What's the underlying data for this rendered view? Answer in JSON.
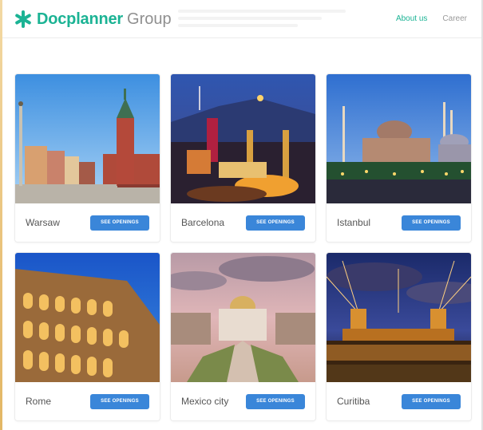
{
  "header": {
    "logo_brand": "Docplanner",
    "logo_group": "Group",
    "brand_color": "#1bb394",
    "nav": {
      "about_label": "About us",
      "career_label": "Career"
    }
  },
  "accent_button_color": "#3a86d9",
  "cities": [
    {
      "name": "Warsaw",
      "button_label": "SEE OPENINGS"
    },
    {
      "name": "Barcelona",
      "button_label": "SEE OPENINGS"
    },
    {
      "name": "Istanbul",
      "button_label": "SEE OPENINGS"
    },
    {
      "name": "Rome",
      "button_label": "SEE OPENINGS"
    },
    {
      "name": "Mexico city",
      "button_label": "SEE OPENINGS"
    },
    {
      "name": "Curitiba",
      "button_label": "SEE OPENINGS"
    }
  ]
}
